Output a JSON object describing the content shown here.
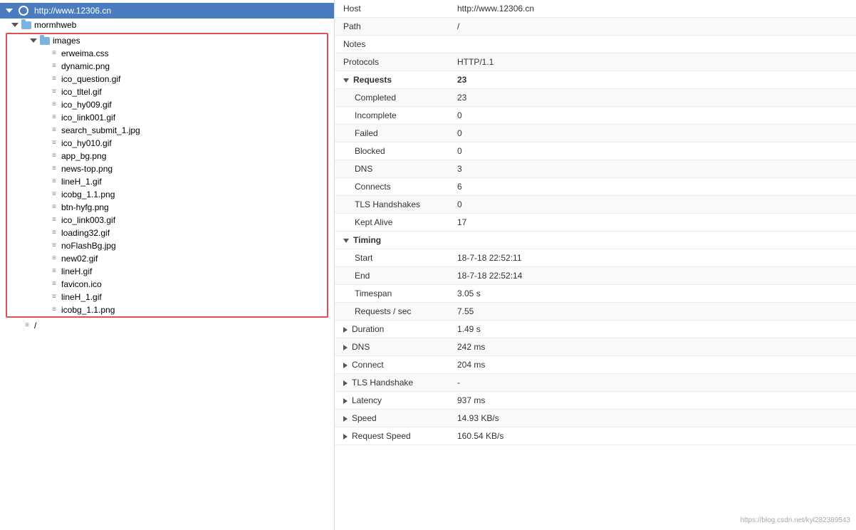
{
  "left": {
    "root": {
      "label": "http://www.12306.cn",
      "expanded": true
    },
    "mormhweb": {
      "label": "mormhweb",
      "expanded": true
    },
    "images": {
      "label": "images",
      "expanded": true
    },
    "files": [
      "erweima.css",
      "dynamic.png",
      "ico_question.gif",
      "ico_tltel.gif",
      "ico_hy009.gif",
      "ico_link001.gif",
      "search_submit_1.jpg",
      "ico_hy010.gif",
      "app_bg.png",
      "news-top.png",
      "lineH_1.gif",
      "icobg_1.1.png",
      "btn-hyfg.png",
      "ico_link003.gif",
      "loading32.gif",
      "noFlashBg.jpg",
      "new02.gif",
      "lineH.gif",
      "favicon.ico",
      "lineH_1.gif",
      "icobg_1.1.png"
    ],
    "slash_label": "/"
  },
  "right": {
    "host_label": "Host",
    "host_value": "http://www.12306.cn",
    "path_label": "Path",
    "path_value": "/",
    "notes_label": "Notes",
    "notes_value": "",
    "protocols_label": "Protocols",
    "protocols_value": "HTTP/1.1",
    "requests_label": "Requests",
    "requests_value": "23",
    "completed_label": "Completed",
    "completed_value": "23",
    "incomplete_label": "Incomplete",
    "incomplete_value": "0",
    "failed_label": "Failed",
    "failed_value": "0",
    "blocked_label": "Blocked",
    "blocked_value": "0",
    "dns_label": "DNS",
    "dns_value": "3",
    "connects_label": "Connects",
    "connects_value": "6",
    "tls_handshakes_label": "TLS Handshakes",
    "tls_handshakes_value": "0",
    "kept_alive_label": "Kept Alive",
    "kept_alive_value": "17",
    "timing_label": "Timing",
    "start_label": "Start",
    "start_value": "18-7-18 22:52:11",
    "end_label": "End",
    "end_value": "18-7-18 22:52:14",
    "timespan_label": "Timespan",
    "timespan_value": "3.05 s",
    "req_sec_label": "Requests / sec",
    "req_sec_value": "7.55",
    "duration_label": "Duration",
    "duration_value": "1.49 s",
    "dns2_label": "DNS",
    "dns2_value": "242 ms",
    "connect_label": "Connect",
    "connect_value": "204 ms",
    "tls_label": "TLS Handshake",
    "tls_value": "-",
    "latency_label": "Latency",
    "latency_value": "937 ms",
    "speed_label": "Speed",
    "speed_value": "14.93 KB/s",
    "req_speed_label": "Request Speed",
    "req_speed_value": "160.54 KB/s",
    "watermark": "https://blog.csdn.net/kyl282389543"
  }
}
